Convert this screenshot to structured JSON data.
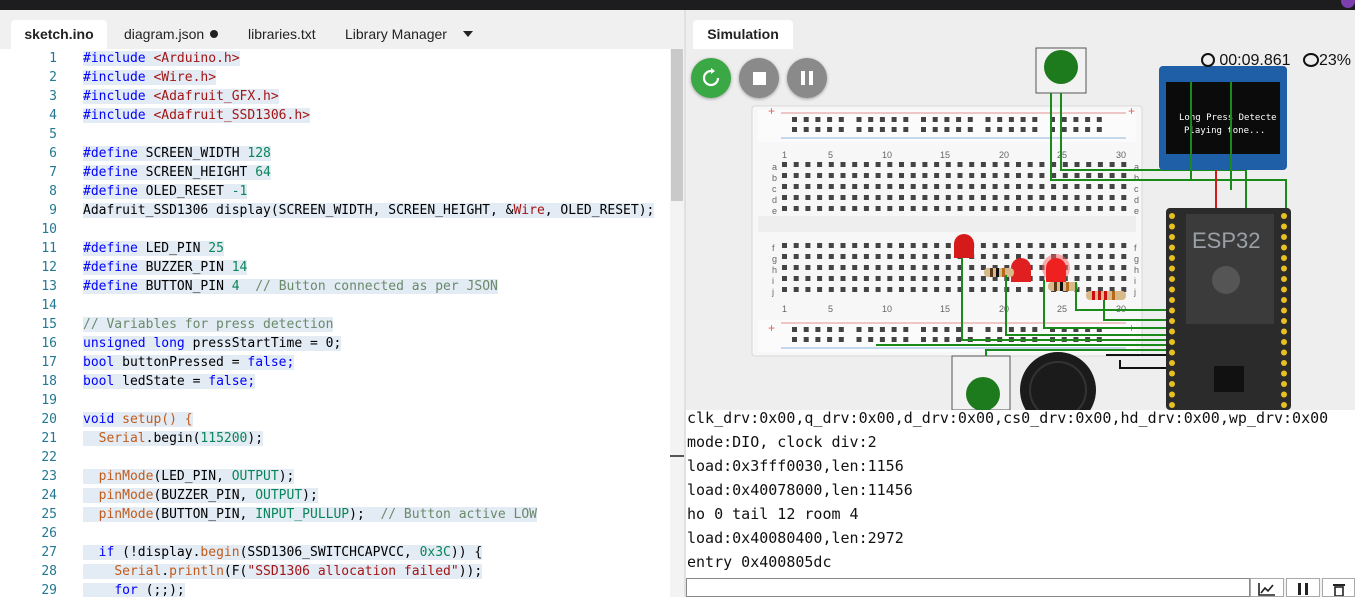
{
  "tabs": [
    {
      "label": "sketch.ino",
      "active": true
    },
    {
      "label": "diagram.json",
      "modified": true
    },
    {
      "label": "libraries.txt"
    },
    {
      "label": "Library Manager"
    }
  ],
  "code_lines": [
    {
      "n": "1"
    },
    {
      "n": "2"
    },
    {
      "n": "3"
    },
    {
      "n": "4"
    },
    {
      "n": "5"
    },
    {
      "n": "6"
    },
    {
      "n": "7"
    },
    {
      "n": "8"
    },
    {
      "n": "9"
    },
    {
      "n": "10"
    },
    {
      "n": "11"
    },
    {
      "n": "12"
    },
    {
      "n": "13"
    },
    {
      "n": "14"
    },
    {
      "n": "15"
    },
    {
      "n": "16"
    },
    {
      "n": "17"
    },
    {
      "n": "18"
    },
    {
      "n": "19"
    },
    {
      "n": "20"
    },
    {
      "n": "21"
    },
    {
      "n": "22"
    },
    {
      "n": "23"
    },
    {
      "n": "24"
    },
    {
      "n": "25"
    },
    {
      "n": "26"
    },
    {
      "n": "27"
    },
    {
      "n": "28"
    },
    {
      "n": "29"
    }
  ],
  "code": {
    "l1": [
      "#include",
      "<Arduino.h>"
    ],
    "l2": [
      "#include",
      "<Wire.h>"
    ],
    "l3": [
      "#include",
      "<Adafruit_GFX.h>"
    ],
    "l4": [
      "#include",
      "<Adafruit_SSD1306.h>"
    ],
    "l6": [
      "#define",
      "SCREEN_WIDTH",
      "128"
    ],
    "l7": [
      "#define",
      "SCREEN_HEIGHT",
      "64"
    ],
    "l8": [
      "#define",
      "OLED_RESET",
      "-1"
    ],
    "l9": [
      "Adafruit_SSD1306 display(SCREEN_WIDTH, SCREEN_HEIGHT, &",
      "Wire",
      ", OLED_RESET);"
    ],
    "l11": [
      "#define",
      "LED_PIN",
      "25"
    ],
    "l12": [
      "#define",
      "BUZZER_PIN",
      "14"
    ],
    "l13": [
      "#define",
      "BUTTON_PIN",
      "4",
      "// Button connected as per JSON"
    ],
    "l15": [
      "// Variables for press detection"
    ],
    "l16": [
      "unsigned",
      "long",
      "pressStartTime",
      "=",
      "0;"
    ],
    "l17": [
      "bool",
      "buttonPressed",
      "=",
      "false;"
    ],
    "l18": [
      "bool",
      "ledState",
      "=",
      "false;"
    ],
    "l20": [
      "void",
      "setup() {"
    ],
    "l21": [
      "Serial",
      ".begin(",
      "115200",
      ");"
    ],
    "l23": [
      "pinMode",
      "(LED_PIN, ",
      "OUTPUT",
      ");"
    ],
    "l24": [
      "pinMode",
      "(BUZZER_PIN, ",
      "OUTPUT",
      ");"
    ],
    "l25": [
      "pinMode",
      "(BUTTON_PIN, ",
      "INPUT_PULLUP",
      ");",
      "// Button active LOW"
    ],
    "l27": [
      "if",
      "(!display.",
      "begin",
      "(SSD1306_SWITCHCAPVCC, ",
      "0x3C",
      ")) {"
    ],
    "l28": [
      "Serial",
      ".",
      "println",
      "(F(",
      "\"SSD1306 allocation failed\"",
      "));"
    ],
    "l29": [
      "for",
      "(;;);"
    ]
  },
  "simulation": {
    "tab_label": "Simulation",
    "timer": "00:09.861",
    "speed": "23%",
    "oled_text": [
      "Long Press Detecte",
      "Playing tone..."
    ],
    "esp_label": "ESP32",
    "board_numbers": [
      "1",
      "5",
      "10",
      "15",
      "20",
      "25",
      "30"
    ],
    "row_letters_top": [
      "a",
      "b",
      "c",
      "d",
      "e"
    ],
    "row_letters_bottom": [
      "f",
      "g",
      "h",
      "i",
      "j"
    ]
  },
  "serial": {
    "lines": [
      "clk_drv:0x00,q_drv:0x00,d_drv:0x00,cs0_drv:0x00,hd_drv:0x00,wp_drv:0x00",
      "mode:DIO, clock div:2",
      "load:0x3fff0030,len:1156",
      "load:0x40078000,len:11456",
      "ho 0 tail 12 room 4",
      "load:0x40080400,len:2972",
      "entry 0x400805dc"
    ],
    "input_value": ""
  },
  "colors": {
    "restart": "#3aa845",
    "stop": "#8a8a8a",
    "pause": "#8a8a8a",
    "esp": "#2b2b2b",
    "wire": "#1a8a1a"
  }
}
